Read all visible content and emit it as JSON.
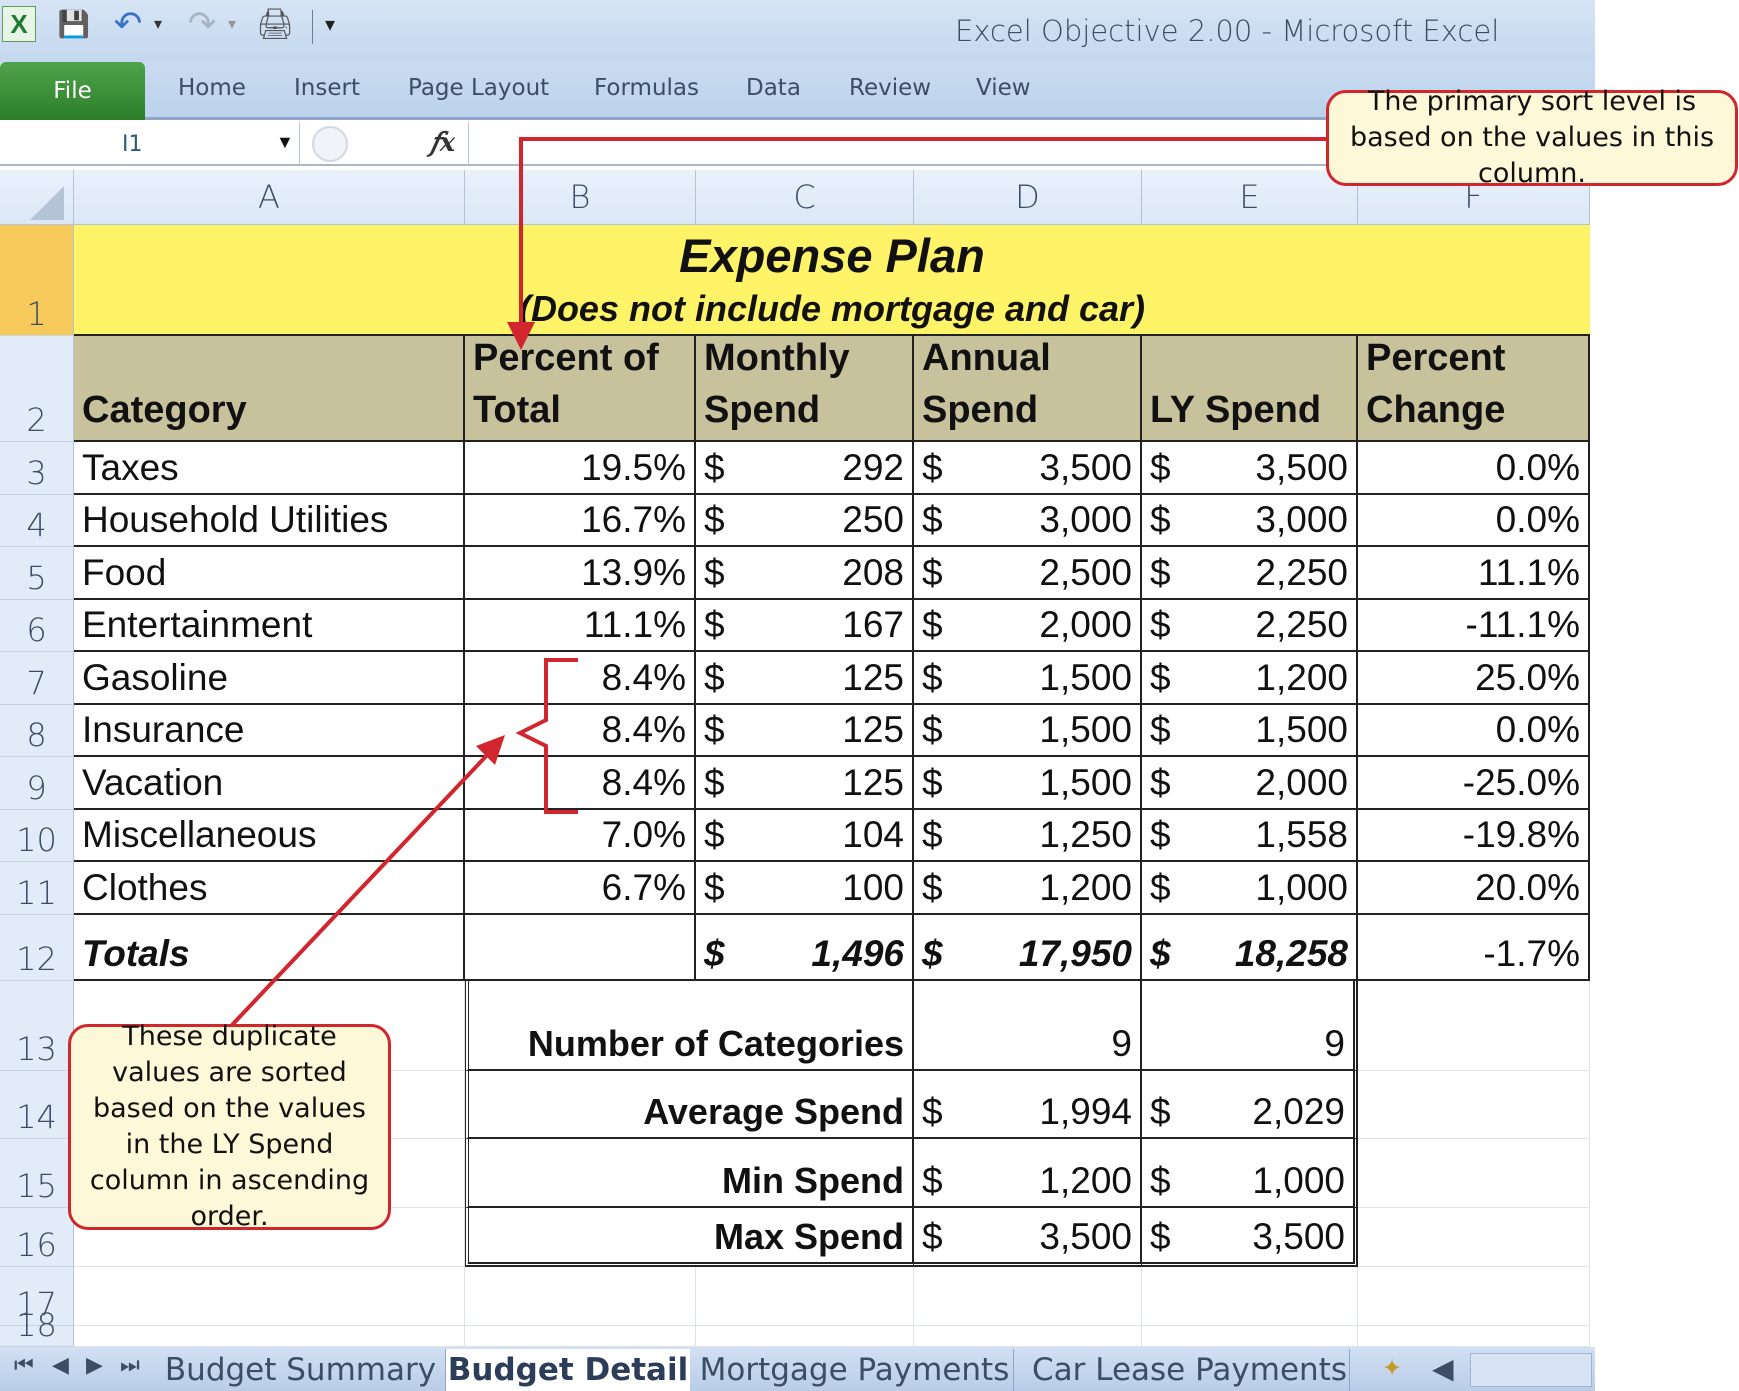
{
  "window": {
    "title": "Excel Objective 2.00  -  Microsoft Excel"
  },
  "quick_access": [
    {
      "icon": "excel-logo-icon",
      "glyph": "X"
    },
    {
      "icon": "save-icon",
      "glyph": "💾"
    },
    {
      "icon": "undo-icon",
      "glyph": "↶"
    },
    {
      "icon": "redo-icon",
      "glyph": "↷"
    },
    {
      "icon": "print-preview-icon",
      "glyph": "🖨"
    },
    {
      "icon": "customize-qat-icon",
      "glyph": "▾"
    }
  ],
  "ribbon": {
    "tabs": [
      "File",
      "Home",
      "Insert",
      "Page Layout",
      "Formulas",
      "Data",
      "Review",
      "View"
    ]
  },
  "formula_bar": {
    "name_box": "I1",
    "fx": "fx",
    "formula": ""
  },
  "columns": [
    "A",
    "B",
    "C",
    "D",
    "E",
    "F"
  ],
  "rows": [
    "1",
    "2",
    "3",
    "4",
    "5",
    "6",
    "7",
    "8",
    "9",
    "10",
    "11",
    "12",
    "13",
    "14",
    "15",
    "16",
    "17",
    "18"
  ],
  "sheet": {
    "title": "Expense Plan",
    "subtitle": "(Does not include mortgage and car)",
    "headers": [
      {
        "line1": "",
        "line2": "Category"
      },
      {
        "line1": "Percent of",
        "line2": "Total"
      },
      {
        "line1": "Monthly",
        "line2": "Spend"
      },
      {
        "line1": "Annual",
        "line2": "Spend"
      },
      {
        "line1": "",
        "line2": "LY Spend"
      },
      {
        "line1": "Percent",
        "line2": "Change"
      }
    ],
    "data": [
      {
        "category": "Taxes",
        "pct": "19.5%",
        "monthly": "292",
        "annual": "3,500",
        "ly": "3,500",
        "change": "0.0%"
      },
      {
        "category": "Household Utilities",
        "pct": "16.7%",
        "monthly": "250",
        "annual": "3,000",
        "ly": "3,000",
        "change": "0.0%"
      },
      {
        "category": "Food",
        "pct": "13.9%",
        "monthly": "208",
        "annual": "2,500",
        "ly": "2,250",
        "change": "11.1%"
      },
      {
        "category": "Entertainment",
        "pct": "11.1%",
        "monthly": "167",
        "annual": "2,000",
        "ly": "2,250",
        "change": "-11.1%"
      },
      {
        "category": "Gasoline",
        "pct": "8.4%",
        "monthly": "125",
        "annual": "1,500",
        "ly": "1,200",
        "change": "25.0%"
      },
      {
        "category": "Insurance",
        "pct": "8.4%",
        "monthly": "125",
        "annual": "1,500",
        "ly": "1,500",
        "change": "0.0%"
      },
      {
        "category": "Vacation",
        "pct": "8.4%",
        "monthly": "125",
        "annual": "1,500",
        "ly": "2,000",
        "change": "-25.0%"
      },
      {
        "category": "Miscellaneous",
        "pct": "7.0%",
        "monthly": "104",
        "annual": "1,250",
        "ly": "1,558",
        "change": "-19.8%"
      },
      {
        "category": "Clothes",
        "pct": "6.7%",
        "monthly": "100",
        "annual": "1,200",
        "ly": "1,000",
        "change": "20.0%"
      }
    ],
    "totals": {
      "label": "Totals",
      "monthly": "1,496",
      "annual": "17,950",
      "ly": "18,258",
      "change": "-1.7%"
    },
    "currency": "$",
    "stats": [
      {
        "label": "Number of Categories",
        "annual": "9",
        "ly": "9",
        "currency": false
      },
      {
        "label": "Average Spend",
        "annual": "1,994",
        "ly": "2,029",
        "currency": true
      },
      {
        "label": "Min Spend",
        "annual": "1,200",
        "ly": "1,000",
        "currency": true
      },
      {
        "label": "Max Spend",
        "annual": "3,500",
        "ly": "3,500",
        "currency": true
      }
    ]
  },
  "callouts": {
    "top": "The primary sort level is based on the values in this column.",
    "bottom": "These duplicate values are sorted based on the values in the LY Spend column in ascending order."
  },
  "sheet_tabs": [
    {
      "label": "Budget Summary",
      "active": false
    },
    {
      "label": "Budget Detail",
      "active": true
    },
    {
      "label": "Mortgage Payments",
      "active": false
    },
    {
      "label": "Car Lease Payments",
      "active": false
    }
  ],
  "colors": {
    "title_fill": "#fff367",
    "header_fill": "#c8c29c",
    "callout_border": "#d2262e",
    "callout_fill": "#fdf8d8",
    "file_tab": "#3a9036"
  }
}
